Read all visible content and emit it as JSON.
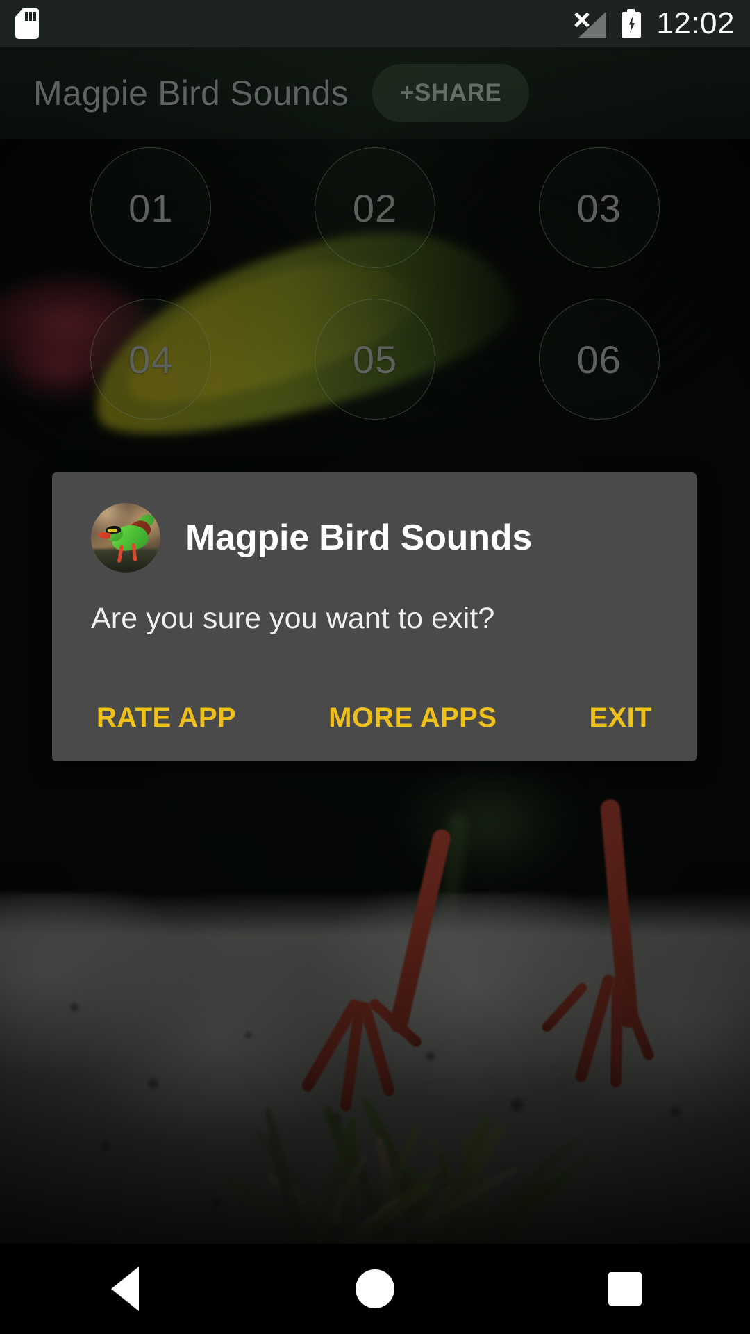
{
  "status_bar": {
    "sd_card_icon": "sd-card-icon",
    "no_signal_icon": "no-signal-icon",
    "battery_charging_icon": "battery-charging-icon",
    "time": "12:02"
  },
  "app_bar": {
    "title": "Magpie Bird Sounds",
    "share_label": "+SHARE"
  },
  "grid": {
    "buttons": [
      {
        "label": "01"
      },
      {
        "label": "02"
      },
      {
        "label": "03"
      },
      {
        "label": "04"
      },
      {
        "label": "05"
      },
      {
        "label": "06"
      }
    ]
  },
  "dialog": {
    "icon": "app-icon-magpie",
    "title": "Magpie Bird Sounds",
    "message": "Are you sure you want to exit?",
    "actions": {
      "rate": "RATE APP",
      "more": "MORE APPS",
      "exit": "EXIT"
    },
    "accent_color": "#EFC01C",
    "background_color": "#4a4a4a"
  },
  "nav_bar": {
    "back_icon": "back-triangle-icon",
    "home_icon": "home-circle-icon",
    "recents_icon": "recents-square-icon"
  }
}
